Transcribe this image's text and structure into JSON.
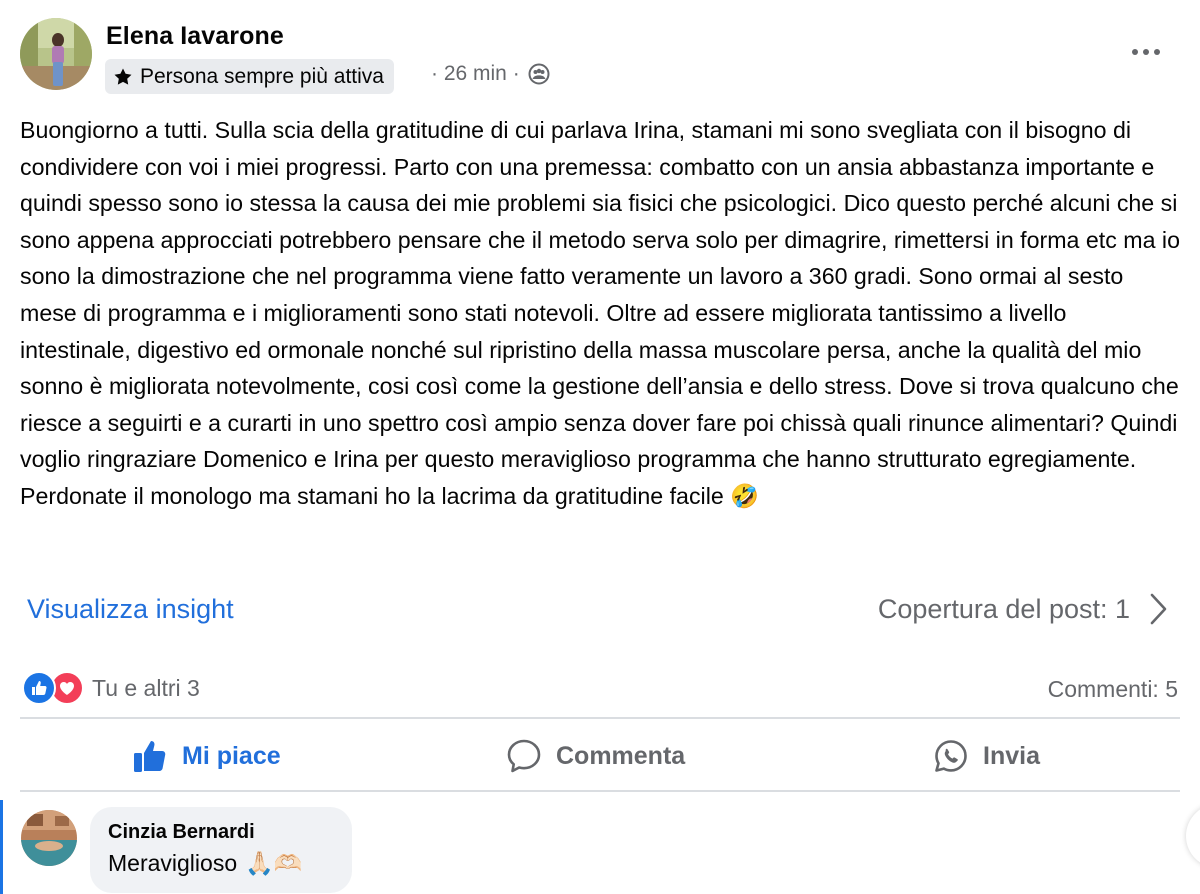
{
  "post": {
    "author": "Elena Iavarone",
    "badge": "Persona sempre più attiva",
    "time": "· 26 min ·",
    "text": "Buongiorno a tutti. Sulla scia della gratitudine di cui parlava Irina, stamani mi sono svegliata con il bisogno di condividere con voi i miei progressi. Parto con una premessa: combatto con un ansia abbastanza importante e quindi spesso sono io stessa la causa dei mie problemi sia fisici che psicologici. Dico questo perché alcuni che si sono appena approcciati potrebbero pensare che il metodo serva solo per dimagrire, rimettersi in forma etc ma io sono la dimostrazione che nel programma viene fatto veramente un lavoro a 360 gradi. Sono ormai al sesto mese di programma e i miglioramenti sono stati notevoli. Oltre ad essere migliorata tantissimo a livello intestinale, digestivo ed ormonale nonché sul ripristino della massa muscolare persa, anche la qualità del mio sonno è migliorata notevolmente, cosi così come la gestione dell’ansia e dello stress. Dove si trova qualcuno che riesce a seguirti e a curarti in uno spettro così ampio senza dover fare poi chissà quali rinunce alimentari? Quindi voglio ringraziare Domenico e Irina per questo meraviglioso programma che hanno strutturato egregiamente.\n Perdonate il monologo ma stamani ho la lacrima da gratitudine facile 🤣"
  },
  "insight": {
    "link": "Visualizza insight",
    "reach": "Copertura del post: 1"
  },
  "reactions": {
    "summary": "Tu e altri 3",
    "comments": "Commenti: 5"
  },
  "actions": {
    "like": "Mi piace",
    "comment": "Commenta",
    "send": "Invia"
  },
  "comment": {
    "author": "Cinzia Bernardi",
    "text": "Meraviglioso",
    "emoji": "🙏🏻🫶🏻"
  },
  "icons": {
    "badge": "star-icon",
    "audience": "group-icon",
    "more": "more-icon",
    "like": "thumbs-up-icon",
    "comment": "comment-bubble-icon",
    "send": "whatsapp-icon",
    "reaction_like": "like-reaction-icon",
    "reaction_love": "love-reaction-icon"
  },
  "colors": {
    "link": "#216fdb",
    "secondary_text": "#65676b",
    "like_blue": "#1b74e4",
    "love_red": "#f33e58"
  }
}
